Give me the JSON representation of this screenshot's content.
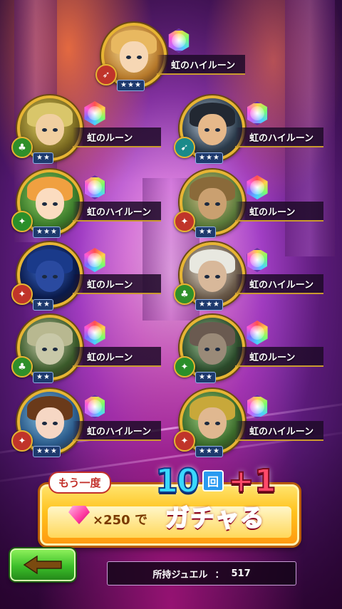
{
  "results": [
    {
      "rune": "虹のハイルーン",
      "rune_type": "high",
      "stars": 3,
      "badge": "bow",
      "badge_color": "#c0342a",
      "hair": "#e8b860",
      "face": "#f6d7b4",
      "c1": "#ffe29a",
      "c2": "#b5782a"
    },
    {
      "rune": "虹のルーン",
      "rune_type": "normal",
      "stars": 2,
      "badge": "leaf",
      "badge_color": "#2f8f2a",
      "hair": "#d9c66a",
      "face": "#f0cfa0",
      "c1": "#e9d86a",
      "c2": "#7a6a20"
    },
    {
      "rune": "虹のハイルーン",
      "rune_type": "high",
      "stars": 3,
      "badge": "arrow",
      "badge_color": "#1a8a8a",
      "hair": "#222832",
      "face": "#e6b88a",
      "c1": "#c9d8e8",
      "c2": "#2a3a4a"
    },
    {
      "rune": "虹のハイルーン",
      "rune_type": "high",
      "stars": 3,
      "badge": "sword",
      "badge_color": "#2a8f2a",
      "hair": "#f0a040",
      "face": "#fbdcc0",
      "c1": "#9ad86a",
      "c2": "#3a7a2a"
    },
    {
      "rune": "虹のルーン",
      "rune_type": "normal",
      "stars": 2,
      "badge": "sword",
      "badge_color": "#c0342a",
      "hair": "#8a6a3a",
      "face": "#caa070",
      "c1": "#d8c08a",
      "c2": "#5a7a3a"
    },
    {
      "rune": "虹のルーン",
      "rune_type": "normal",
      "stars": 2,
      "badge": "sword",
      "badge_color": "#c0342a",
      "hair": "#1a3a8a",
      "face": "#2a4aa0",
      "c1": "#3a6ad0",
      "c2": "#0a1a4a"
    },
    {
      "rune": "虹のハイルーン",
      "rune_type": "high",
      "stars": 3,
      "badge": "leaf",
      "badge_color": "#2f8f2a",
      "hair": "#e8e8e0",
      "face": "#d8b89a",
      "c1": "#f0e8d8",
      "c2": "#6a5a4a"
    },
    {
      "rune": "虹のルーン",
      "rune_type": "normal",
      "stars": 2,
      "badge": "leaf",
      "badge_color": "#2f8f2a",
      "hair": "#b8b890",
      "face": "#c8c8a8",
      "c1": "#d8d8b8",
      "c2": "#3a5a2a"
    },
    {
      "rune": "虹のルーン",
      "rune_type": "normal",
      "stars": 2,
      "badge": "sword",
      "badge_color": "#2a8f2a",
      "hair": "#6a5a50",
      "face": "#9a8a78",
      "c1": "#a8d0a0",
      "c2": "#2a4a2a"
    },
    {
      "rune": "虹のハイルーン",
      "rune_type": "high",
      "stars": 3,
      "badge": "sword",
      "badge_color": "#c0342a",
      "hair": "#6a3a1a",
      "face": "#f6d7c4",
      "c1": "#8ac8e8",
      "c2": "#2a5a8a"
    },
    {
      "rune": "虹のハイルーン",
      "rune_type": "high",
      "stars": 3,
      "badge": "sword",
      "badge_color": "#c0342a",
      "hair": "#c8a83a",
      "face": "#e0b890",
      "c1": "#a8d88a",
      "c2": "#3a6a2a"
    }
  ],
  "banner": {
    "again_label": "もう一度",
    "count_main": "10",
    "count_unit": "回",
    "count_bonus": "+1",
    "price": "×250",
    "price_suffix": "で",
    "action": "ガチャる"
  },
  "footer": {
    "back_arrow": "←",
    "jewel_label": "所持ジュエル",
    "jewel_separator": "：",
    "jewel_value": "517"
  },
  "colors": {
    "accent_gold": "#e7b533",
    "button_green": "#3cbf2a",
    "banner_yellow": "#ffc21d",
    "gacharu_red": "#ff3a5a"
  }
}
